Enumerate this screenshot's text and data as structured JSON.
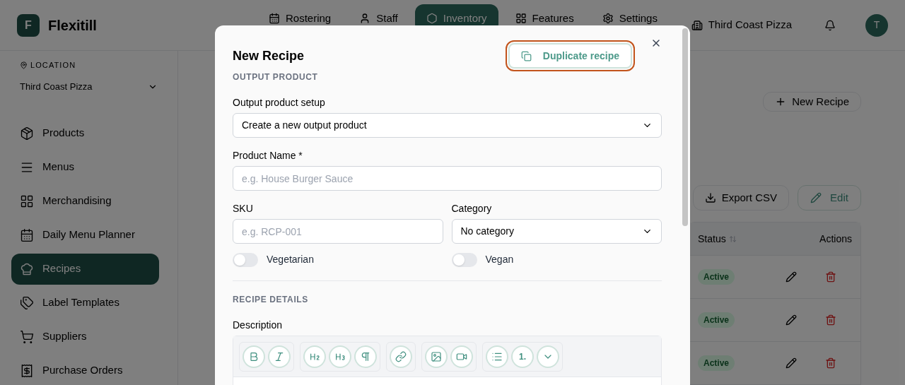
{
  "app": {
    "logo_letter": "F",
    "name": "Flexitill"
  },
  "nav": [
    {
      "label": "Rostering",
      "selected": false
    },
    {
      "label": "Staff",
      "selected": false
    },
    {
      "label": "Inventory",
      "selected": true
    },
    {
      "label": "Features",
      "selected": false
    },
    {
      "label": "Settings",
      "selected": false
    }
  ],
  "store": "Third Coast Pizza",
  "avatar": "T",
  "sidebar": {
    "location_label": "LOCATION",
    "location": "Third Coast Pizza",
    "items": [
      {
        "label": "Products",
        "selected": false
      },
      {
        "label": "Menus",
        "selected": false
      },
      {
        "label": "Merchandising",
        "selected": false
      },
      {
        "label": "Daily Menu Planner",
        "selected": false
      },
      {
        "label": "Recipes",
        "selected": true
      },
      {
        "label": "Label Templates",
        "selected": false
      },
      {
        "label": "Suppliers",
        "selected": false
      },
      {
        "label": "Purchase Orders",
        "selected": false
      }
    ]
  },
  "page": {
    "new_button": "New Recipe",
    "export_button": "Export CSV",
    "edit_button": "Edit",
    "columns": [
      "Status",
      "Actions"
    ],
    "rows": [
      {
        "status": "Active"
      },
      {
        "status": "Active"
      },
      {
        "status": "Active"
      }
    ]
  },
  "modal": {
    "title": "New Recipe",
    "duplicate_button": "Duplicate recipe",
    "output_section": "OUTPUT PRODUCT",
    "setup": {
      "label": "Output product setup",
      "value": "Create a new output product"
    },
    "product_name": {
      "label": "Product Name *",
      "placeholder": "e.g. House Burger Sauce"
    },
    "sku": {
      "label": "SKU",
      "placeholder": "e.g. RCP-001"
    },
    "category": {
      "label": "Category",
      "value": "No category"
    },
    "toggles": [
      {
        "label": "Vegetarian",
        "on": false
      },
      {
        "label": "Vegan",
        "on": false
      }
    ],
    "details_section": "RECIPE DETAILS",
    "description_label": "Description",
    "ordered_list_label": "1."
  }
}
